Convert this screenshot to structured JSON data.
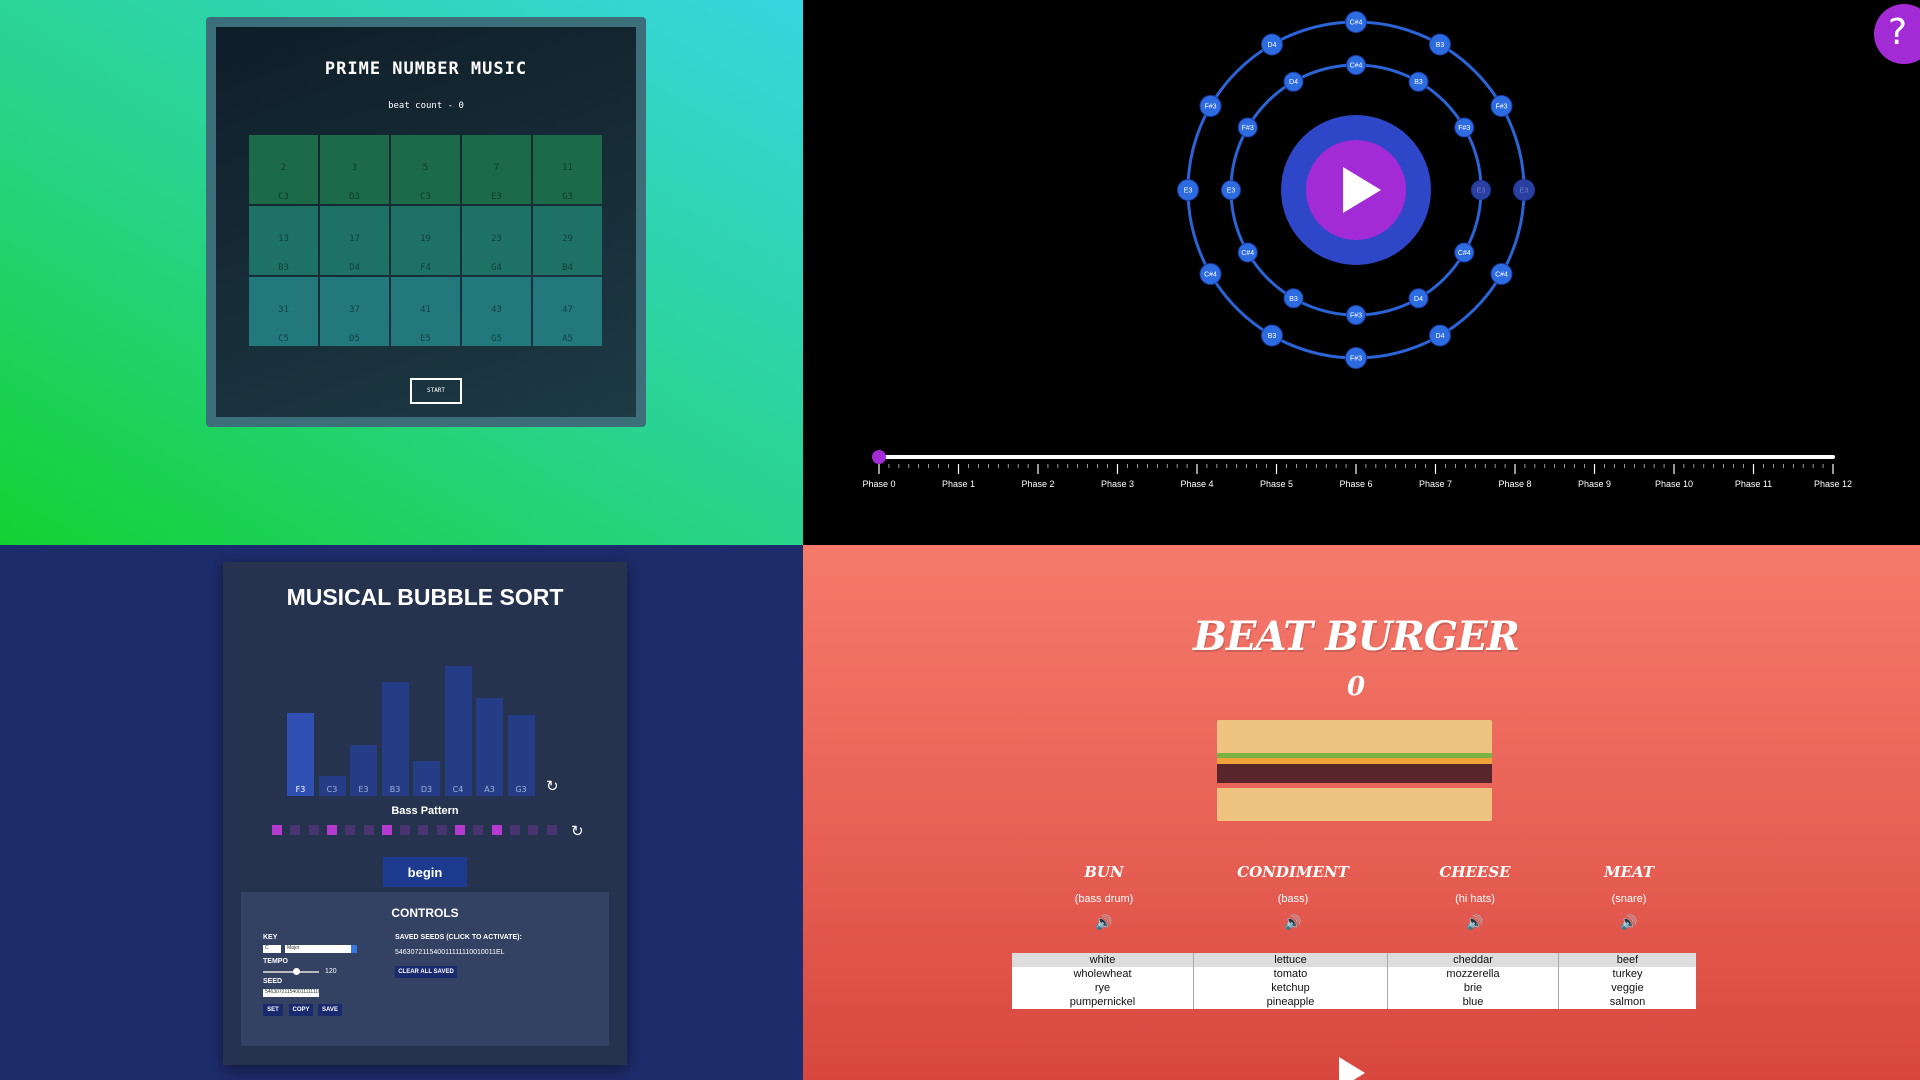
{
  "prime_music": {
    "title": "PRIME NUMBER MUSIC",
    "beat_count": "beat count - 0",
    "start_label": "START",
    "cells": [
      {
        "n": "2",
        "note": "C3"
      },
      {
        "n": "3",
        "note": "D3"
      },
      {
        "n": "5",
        "note": "C3"
      },
      {
        "n": "7",
        "note": "E3"
      },
      {
        "n": "11",
        "note": "G3"
      },
      {
        "n": "13",
        "note": "B3"
      },
      {
        "n": "17",
        "note": "D4"
      },
      {
        "n": "19",
        "note": "F4"
      },
      {
        "n": "23",
        "note": "G4"
      },
      {
        "n": "29",
        "note": "B4"
      },
      {
        "n": "31",
        "note": "C5"
      },
      {
        "n": "37",
        "note": "D5"
      },
      {
        "n": "41",
        "note": "E5"
      },
      {
        "n": "43",
        "note": "G5"
      },
      {
        "n": "47",
        "note": "A5"
      }
    ],
    "cell_colors": [
      "#1c6a4a",
      "#1e7265",
      "#22787a"
    ]
  },
  "circle": {
    "outer_nodes": [
      "C#4",
      "B3",
      "F#3",
      "E3",
      "C#4",
      "D4",
      "F#3",
      "B3",
      "C#4",
      "E3",
      "F#3",
      "D4"
    ],
    "inner_nodes": [
      "C#4",
      "B3",
      "F#3",
      "E3",
      "C#4",
      "D4",
      "F#3",
      "B3",
      "C#4",
      "E3",
      "F#3",
      "D4"
    ],
    "phases": [
      "Phase 0",
      "Phase 1",
      "Phase 2",
      "Phase 3",
      "Phase 4",
      "Phase 5",
      "Phase 6",
      "Phase 7",
      "Phase 8",
      "Phase 9",
      "Phase 10",
      "Phase 11",
      "Phase 12"
    ],
    "slider_value": 0,
    "help_label": "?",
    "colors": {
      "ring": "#2b64d6",
      "node": "#2d6be0",
      "center": "#2e47c9",
      "play": "#a32bd6"
    }
  },
  "bubble_sort": {
    "title": "MUSICAL BUBBLE SORT",
    "bars": [
      {
        "note": "F3",
        "value": 5,
        "active": true
      },
      {
        "note": "C3",
        "value": 1,
        "active": false
      },
      {
        "note": "E3",
        "value": 3,
        "active": false
      },
      {
        "note": "B3",
        "value": 7,
        "active": false
      },
      {
        "note": "D3",
        "value": 2,
        "active": false
      },
      {
        "note": "C4",
        "value": 8,
        "active": false
      },
      {
        "note": "A3",
        "value": 6,
        "active": false
      },
      {
        "note": "G3",
        "value": 4.9,
        "active": false
      }
    ],
    "bass_title": "Bass Pattern",
    "bass_pattern": [
      1,
      0,
      0,
      1,
      0,
      0,
      1,
      0,
      0,
      0,
      1,
      0,
      1,
      0,
      0,
      0
    ],
    "begin_label": "begin",
    "controls": {
      "title": "CONTROLS",
      "key_label": "KEY",
      "key_value": "C",
      "mode_value": "Major",
      "tempo_label": "TEMPO",
      "tempo_value": "120",
      "seed_label": "SEED",
      "seed_value": "5463072115400111111100100",
      "set_label": "SET",
      "copy_label": "COPY",
      "save_label": "SAVE",
      "saved_title": "SAVED SEEDS (CLICK TO ACTIVATE):",
      "saved_seed": "546307211540011111110010011EL",
      "clear_label": "CLEAR ALL SAVED"
    }
  },
  "beat_burger": {
    "title": "BEAT BURGER",
    "score": "0",
    "columns": [
      {
        "head": "BUN",
        "sub": "(bass drum)",
        "options": [
          "white",
          "wholewheat",
          "rye",
          "pumpernickel"
        ]
      },
      {
        "head": "CONDIMENT",
        "sub": "(bass)",
        "options": [
          "lettuce",
          "tomato",
          "ketchup",
          "pineapple"
        ]
      },
      {
        "head": "CHEESE",
        "sub": "(hi hats)",
        "options": [
          "cheddar",
          "mozzerella",
          "brie",
          "blue"
        ]
      },
      {
        "head": "MEAT",
        "sub": "(snare)",
        "options": [
          "beef",
          "turkey",
          "veggie",
          "salmon"
        ]
      }
    ],
    "selected_index": 0,
    "layer_colors": {
      "bun": "#eec27f",
      "lettuce": "#79b243",
      "cheese": "#f0a23a",
      "patty": "#58262a"
    }
  }
}
